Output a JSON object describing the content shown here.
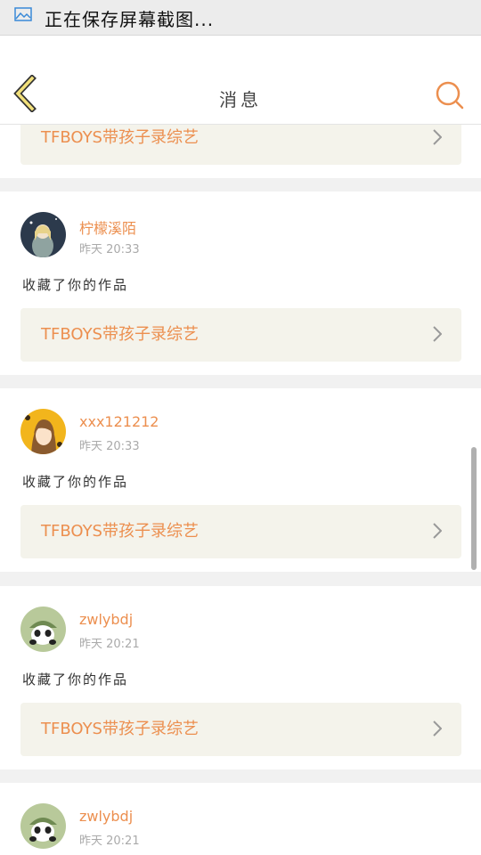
{
  "status_bar": {
    "text": "正在保存屏幕截图..."
  },
  "header": {
    "title": "消息"
  },
  "colors": {
    "accent": "#ec8f4f",
    "card_bg": "#f4f3eb",
    "back_arrow": "#f2e07a"
  },
  "messages": [
    {
      "work_title": "TFBOYS带孩子录综艺"
    },
    {
      "username": "柠檬溪陌",
      "time": "昨天 20:33",
      "action": "收藏了你的作品",
      "work_title": "TFBOYS带孩子录综艺"
    },
    {
      "username": "xxx121212",
      "time": "昨天 20:33",
      "action": "收藏了你的作品",
      "work_title": "TFBOYS带孩子录综艺"
    },
    {
      "username": "zwlybdj",
      "time": "昨天 20:21",
      "action": "收藏了你的作品",
      "work_title": "TFBOYS带孩子录综艺"
    },
    {
      "username": "zwlybdj",
      "time": "昨天 20:21"
    }
  ]
}
